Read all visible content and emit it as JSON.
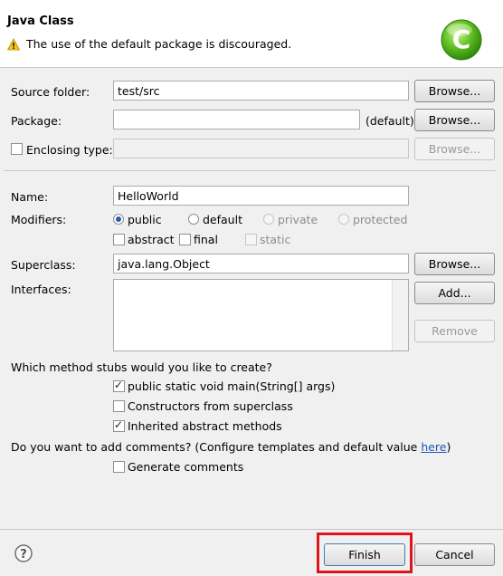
{
  "header": {
    "title": "Java Class",
    "warning": "The use of the default package is discouraged.",
    "logo_letter": "C"
  },
  "source_folder": {
    "label": "Source folder:",
    "value": "test/src",
    "browse": "Browse..."
  },
  "package": {
    "label": "Package:",
    "value": "",
    "default_hint": "(default)",
    "browse": "Browse..."
  },
  "enclosing": {
    "label": "Enclosing type:",
    "value": "",
    "checked": false,
    "browse": "Browse..."
  },
  "name": {
    "label": "Name:",
    "value": "HelloWorld"
  },
  "modifiers": {
    "label": "Modifiers:",
    "public": "public",
    "default": "default",
    "private": "private",
    "protected": "protected",
    "abstract": "abstract",
    "final": "final",
    "static": "static"
  },
  "superclass": {
    "label": "Superclass:",
    "value": "java.lang.Object",
    "browse": "Browse..."
  },
  "interfaces": {
    "label": "Interfaces:",
    "add": "Add...",
    "remove": "Remove"
  },
  "stubs": {
    "question": "Which method stubs would you like to create?",
    "main": "public static void main(String[] args)",
    "constructors": "Constructors from superclass",
    "inherited": "Inherited abstract methods"
  },
  "comments": {
    "question": "Do you want to add comments? (Configure templates and default value ",
    "link": "here",
    "close": ")",
    "generate": "Generate comments"
  },
  "footer": {
    "finish": "Finish",
    "cancel": "Cancel",
    "help": "?"
  }
}
